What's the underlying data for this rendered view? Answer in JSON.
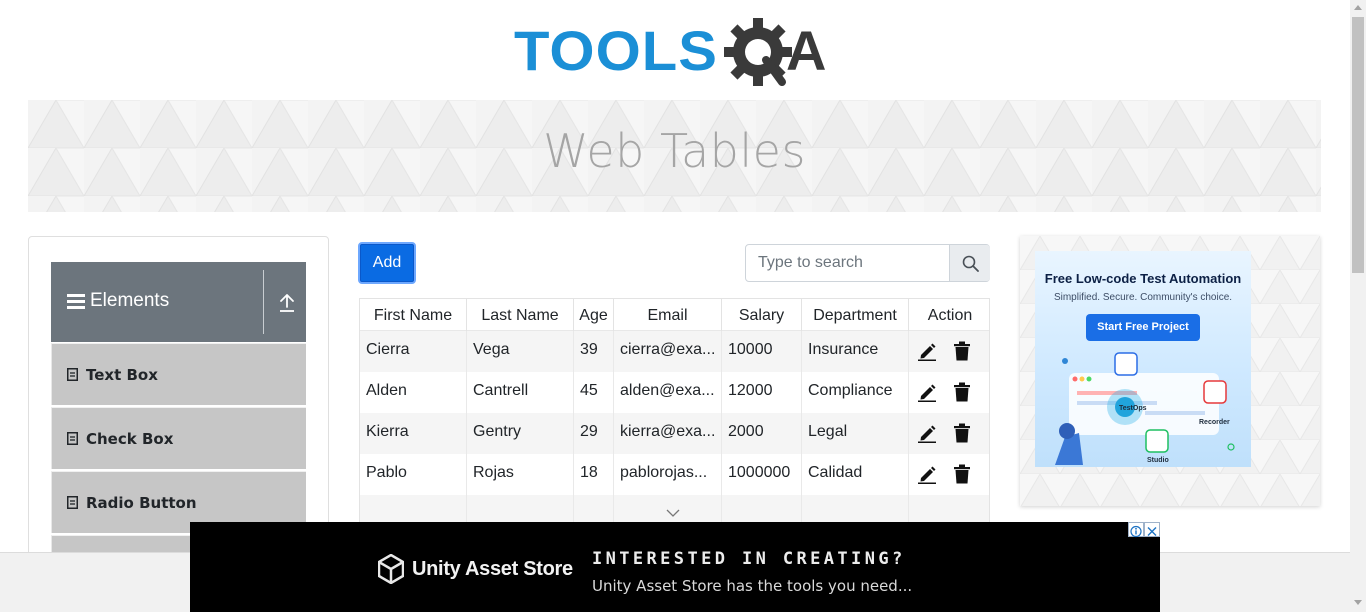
{
  "header": {
    "logo_text_left": "TOOLS",
    "logo_text_right": "QA",
    "logo_colors": {
      "tools": "#1b8fd6",
      "qa": "#3a3a3a"
    }
  },
  "banner": {
    "title": "Web Tables"
  },
  "sidebar": {
    "group_title": "Elements",
    "group_icon": "menu-icon",
    "collapse_icon": "collapse-up-icon",
    "items": [
      {
        "label": "Text Box",
        "icon": "file-icon"
      },
      {
        "label": "Check Box",
        "icon": "file-icon"
      },
      {
        "label": "Radio Button",
        "icon": "file-icon"
      }
    ]
  },
  "toolbar": {
    "add_label": "Add",
    "search_placeholder": "Type to search",
    "search_value": "",
    "search_icon": "search-icon"
  },
  "table": {
    "columns": [
      "First Name",
      "Last Name",
      "Age",
      "Email",
      "Salary",
      "Department",
      "Action"
    ],
    "rows": [
      {
        "first": "Cierra",
        "last": "Vega",
        "age": "39",
        "email": "cierra@exa...",
        "salary": "10000",
        "department": "Insurance"
      },
      {
        "first": "Alden",
        "last": "Cantrell",
        "age": "45",
        "email": "alden@exa...",
        "salary": "12000",
        "department": "Compliance"
      },
      {
        "first": "Kierra",
        "last": "Gentry",
        "age": "29",
        "email": "kierra@exa...",
        "salary": "2000",
        "department": "Legal"
      },
      {
        "first": "Pablo",
        "last": "Rojas",
        "age": "18",
        "email": "pablorojas...",
        "salary": "1000000",
        "department": "Calidad"
      }
    ],
    "row_action_icons": [
      "edit-icon",
      "delete-icon"
    ]
  },
  "ad_right": {
    "headline": "Free Low-code Test Automation",
    "subline": "Simplified. Secure. Community's choice.",
    "cta": "Start Free Project",
    "labels": [
      "TestOps",
      "Recorder",
      "Studio"
    ],
    "accent": "#1a6ee6"
  },
  "ad_bottom": {
    "brand": "Unity Asset Store",
    "headline": "INTERESTED IN CREATING?",
    "subline": "Unity Asset Store has the tools you need...",
    "adchoices_icon": "info-icon",
    "close_icon": "close-icon"
  }
}
